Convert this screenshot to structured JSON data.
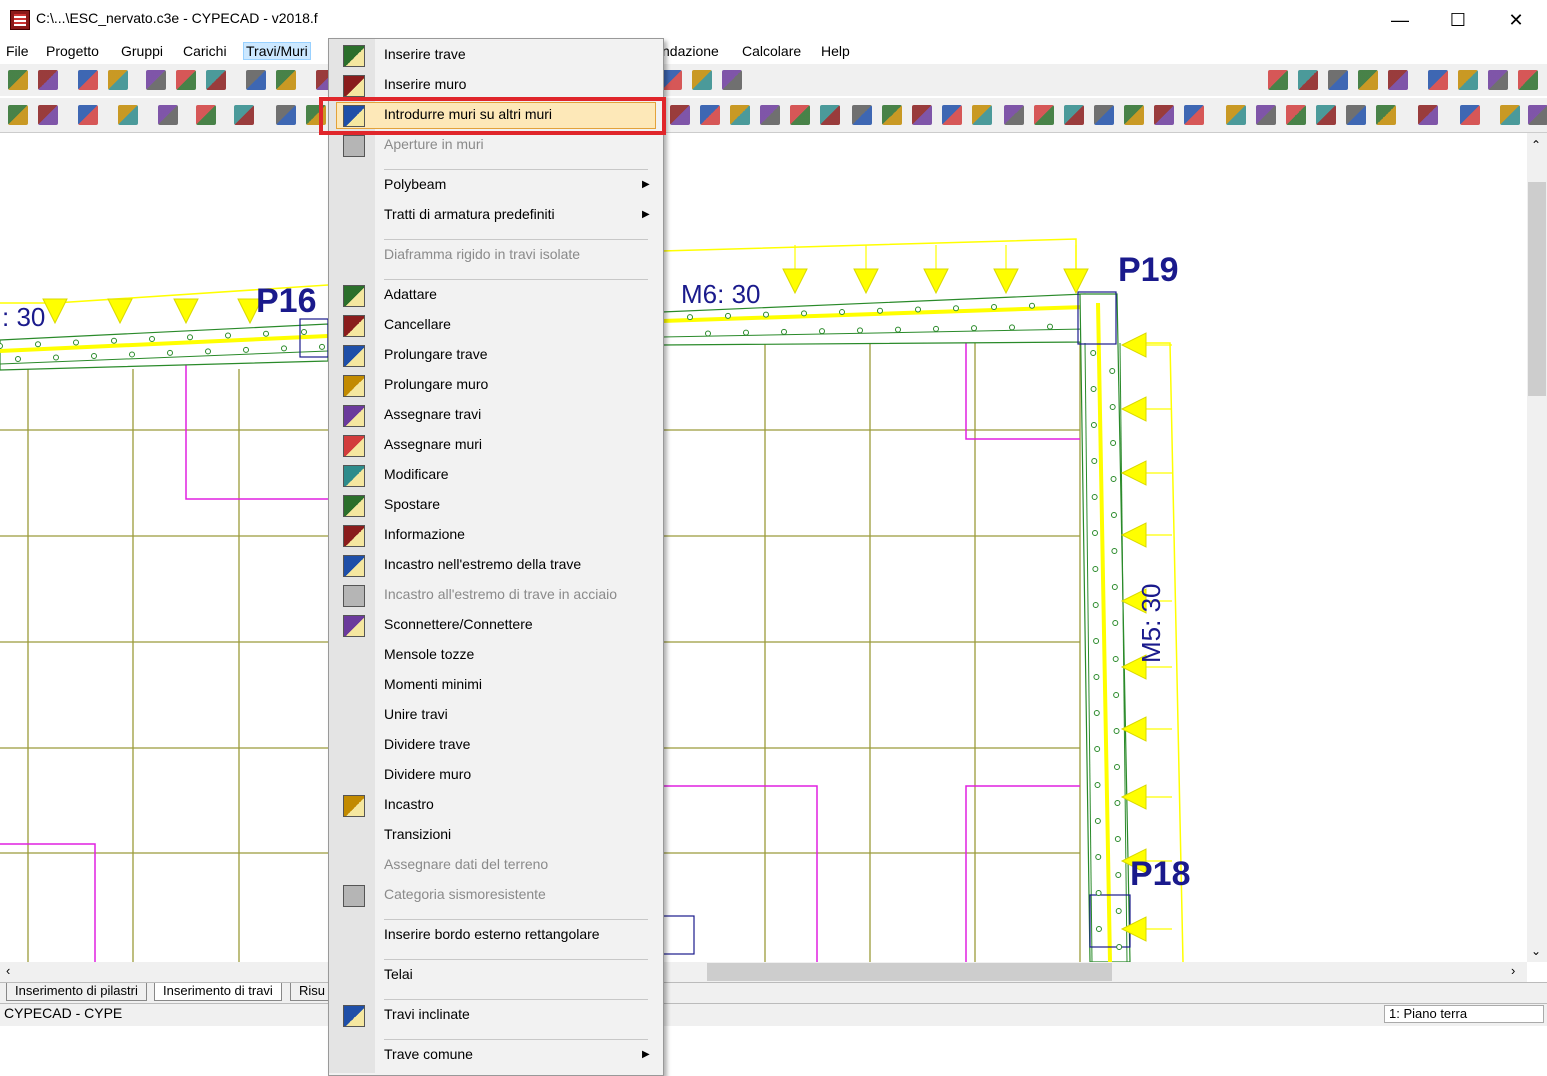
{
  "window": {
    "title": "C:\\...\\ESC_nervato.c3e - CYPECAD - v2018.f",
    "controls": {
      "minimize": "—",
      "maximize": "☐",
      "close": "✕"
    }
  },
  "menubar": {
    "file": "File",
    "progetto": "Progetto",
    "gruppi": "Gruppi",
    "carichi": "Carichi",
    "travi_muri": "Travi/Muri",
    "fondazione": "ndazione",
    "calcolare": "Calcolare",
    "help": "Help"
  },
  "dropdown": {
    "items": [
      {
        "label": "Inserire trave",
        "enabled": true,
        "icon": "insert-beam-icon"
      },
      {
        "label": "Inserire muro",
        "enabled": true,
        "icon": "insert-wall-icon"
      },
      {
        "label": "Introdurre muri su altri muri",
        "enabled": true,
        "icon": "wall-on-wall-icon",
        "highlighted": true
      },
      {
        "label": "Aperture in muri",
        "enabled": false,
        "icon": "wall-openings-icon"
      },
      {
        "label": "Polybeam",
        "enabled": true,
        "submenu": true
      },
      {
        "label": "Tratti di armatura predefiniti",
        "enabled": true,
        "submenu": true
      },
      {
        "label": "Diaframma rigido in travi isolate",
        "enabled": false
      },
      {
        "label": "Adattare",
        "enabled": true,
        "icon": "adapt-icon"
      },
      {
        "label": "Cancellare",
        "enabled": true,
        "icon": "delete-icon"
      },
      {
        "label": "Prolungare trave",
        "enabled": true,
        "icon": "extend-beam-icon"
      },
      {
        "label": "Prolungare muro",
        "enabled": true,
        "icon": "extend-wall-icon"
      },
      {
        "label": "Assegnare travi",
        "enabled": true,
        "icon": "assign-beams-icon"
      },
      {
        "label": "Assegnare muri",
        "enabled": true,
        "icon": "assign-walls-icon"
      },
      {
        "label": "Modificare",
        "enabled": true,
        "icon": "edit-icon"
      },
      {
        "label": "Spostare",
        "enabled": true,
        "icon": "move-icon"
      },
      {
        "label": "Informazione",
        "enabled": true,
        "icon": "info-icon"
      },
      {
        "label": "Incastro nell'estremo della trave",
        "enabled": true,
        "icon": "beam-end-fixity-icon"
      },
      {
        "label": "Incastro all'estremo di trave in acciaio",
        "enabled": false,
        "icon": "steel-beam-fixity-icon"
      },
      {
        "label": "Sconnettere/Connettere",
        "enabled": true,
        "icon": "connect-icon"
      },
      {
        "label": "Mensole tozze",
        "enabled": true
      },
      {
        "label": "Momenti minimi",
        "enabled": true
      },
      {
        "label": "Unire travi",
        "enabled": true
      },
      {
        "label": "Dividere trave",
        "enabled": true
      },
      {
        "label": "Dividere muro",
        "enabled": true
      },
      {
        "label": "Incastro",
        "enabled": true,
        "icon": "fixity-icon"
      },
      {
        "label": "Transizioni",
        "enabled": true
      },
      {
        "label": "Assegnare dati del terreno",
        "enabled": false
      },
      {
        "label": "Categoria sismoresistente",
        "enabled": false,
        "icon": "seismic-category-icon"
      },
      {
        "label": "Inserire bordo esterno rettangolare",
        "enabled": true
      },
      {
        "label": "Telai",
        "enabled": true
      },
      {
        "label": "Travi inclinate",
        "enabled": true,
        "icon": "inclined-beams-icon"
      },
      {
        "label": "Trave comune",
        "enabled": true,
        "submenu": true
      }
    ]
  },
  "drawing": {
    "labels": {
      "p16": "P16",
      "p19": "P19",
      "p18": "P18",
      "m6": "M6: 30",
      "m5": "M5: 30",
      "left_partial": ": 30"
    },
    "colors": {
      "grid": "#9b9b3a",
      "pink": "#e020e0",
      "wall_green": "#2a8a2a",
      "load_yellow": "#ffff00",
      "node_blue": "#1a1a8c"
    }
  },
  "tabs": {
    "pilastri": "Inserimento di pilastri",
    "travi": "Inserimento di travi",
    "risultati": "Risu"
  },
  "statusbar": {
    "left": "CYPECAD - CYPE",
    "floor": "1: Piano terra"
  }
}
